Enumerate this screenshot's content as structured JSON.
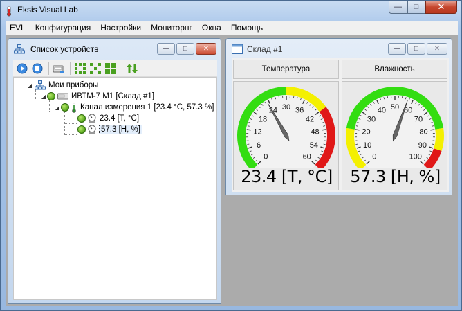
{
  "app": {
    "title": "Eksis Visual Lab"
  },
  "menu": [
    "EVL",
    "Конфигурация",
    "Настройки",
    "Мониторнг",
    "Окна",
    "Помощь"
  ],
  "devices_window": {
    "title": "Список устройств",
    "tree": {
      "root": "Мои приборы",
      "device": "ИВТМ-7 М1 [Склад #1]",
      "channel": "Канал измерения 1 [23.4 °C, 57.3 %]",
      "param_temp": "23.4 [T, °C]",
      "param_hum": "57.3 [H, %]"
    }
  },
  "warehouse_window": {
    "title": "Склад #1",
    "gauges": [
      {
        "header": "Температура",
        "readout": "23.4 [T, °C]",
        "value": 23.4,
        "min": 0,
        "max": 60,
        "ticks": [
          "0",
          "6",
          "12",
          "18",
          "24",
          "30",
          "36",
          "42",
          "48",
          "54",
          "60"
        ],
        "zones": [
          {
            "from": 0,
            "to": 30,
            "color": "#33dd11"
          },
          {
            "from": 30,
            "to": 42,
            "color": "#f4f000"
          },
          {
            "from": 42,
            "to": 60,
            "color": "#e01818"
          }
        ]
      },
      {
        "header": "Влажность",
        "readout": "57.3 [H, %]",
        "value": 57.3,
        "min": 0,
        "max": 100,
        "ticks": [
          "0",
          "10",
          "20",
          "30",
          "40",
          "50",
          "60",
          "70",
          "80",
          "90",
          "100"
        ],
        "zones": [
          {
            "from": 0,
            "to": 20,
            "color": "#f4f000"
          },
          {
            "from": 20,
            "to": 80,
            "color": "#33dd11"
          },
          {
            "from": 80,
            "to": 90,
            "color": "#f4f000"
          },
          {
            "from": 90,
            "to": 100,
            "color": "#e01818"
          }
        ]
      }
    ]
  },
  "colors": {
    "mdi_background": "#ababab",
    "node_status": "#57a81c"
  }
}
